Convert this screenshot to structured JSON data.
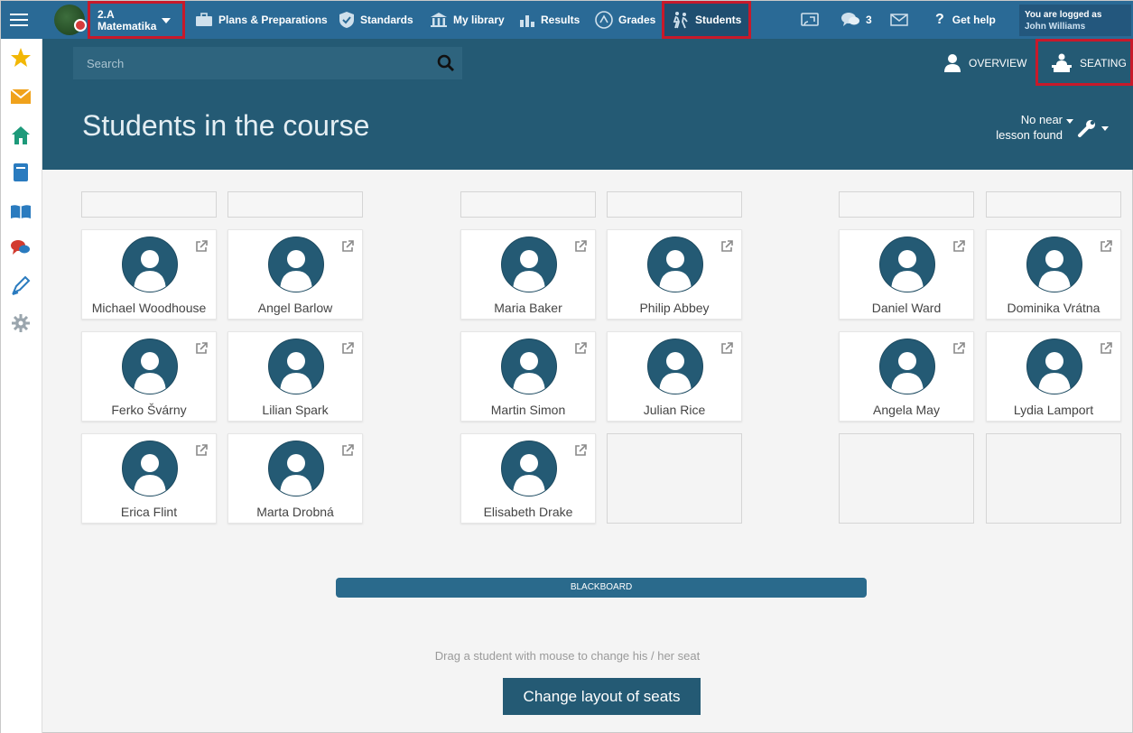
{
  "nav": {
    "course_line1": "2.A",
    "course_line2": "Matematika",
    "plans": "Plans & Preparations",
    "standards": "Standards",
    "library": "My library",
    "results": "Results",
    "grades": "Grades",
    "students": "Students",
    "messages_count": "3",
    "help": "Get help",
    "logged_label": "You are logged as",
    "user": "John Williams"
  },
  "header": {
    "search_placeholder": "Search",
    "overview": "OVERVIEW",
    "seating": "SEATING",
    "title": "Students in the course",
    "near_line1": "No near",
    "near_line2": "lesson found"
  },
  "seats": {
    "r1": [
      "Michael Woodhouse",
      "Angel Barlow",
      "Maria Baker",
      "Philip Abbey",
      "Daniel Ward",
      "Dominika Vrátna"
    ],
    "r2": [
      "Ferko Švárny",
      "Lilian Spark",
      "Martin Simon",
      "Julian Rice",
      "Angela May",
      "Lydia Lamport"
    ],
    "r3": [
      "Erica Flint",
      "Marta Drobná",
      "Elisabeth Drake"
    ]
  },
  "blackboard": "BLACKBOARD",
  "hint": "Drag a student with mouse to change his / her seat",
  "change_button": "Change layout of seats",
  "colors": {
    "nav": "#2a6a96",
    "header": "#245a74",
    "highlight": "#c8192a",
    "avatar": "#245a74"
  }
}
